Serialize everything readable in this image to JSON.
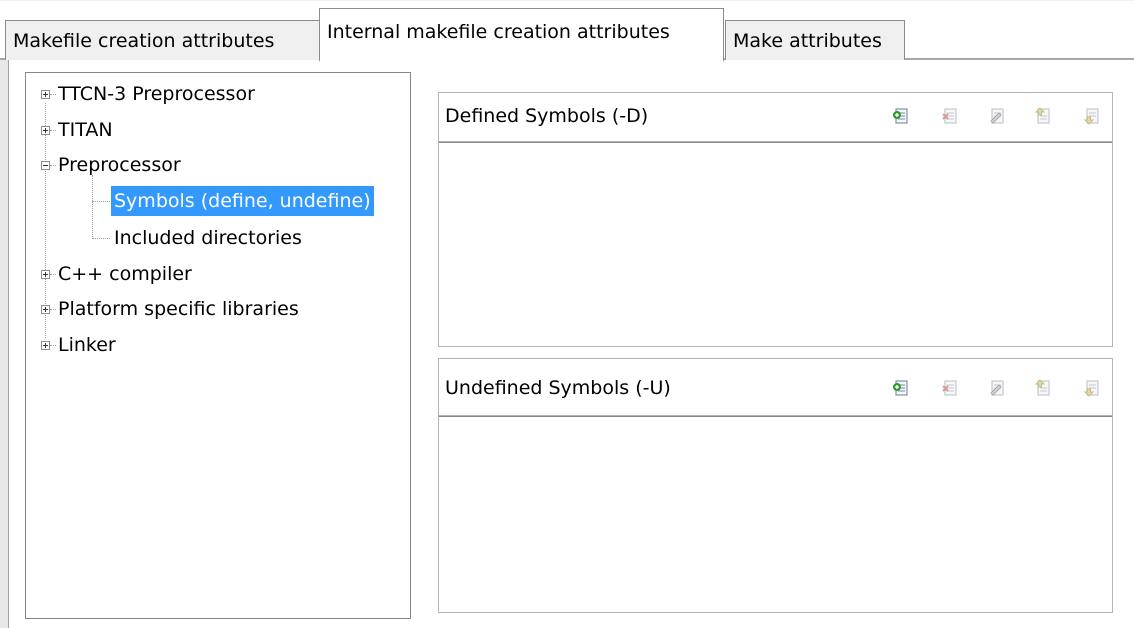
{
  "tabs": [
    {
      "label": "Makefile creation attributes"
    },
    {
      "label": "Internal makefile creation attributes"
    },
    {
      "label": "Make attributes"
    }
  ],
  "active_tab": "Internal makefile creation attributes",
  "tree": {
    "items": [
      {
        "label": "TTCN-3 Preprocessor",
        "expander": "plus"
      },
      {
        "label": "TITAN",
        "expander": "plus"
      },
      {
        "label": "Preprocessor",
        "expander": "minus"
      },
      {
        "label": "Symbols (define, undefine)",
        "selected": true
      },
      {
        "label": "Included directories"
      },
      {
        "label": "C++ compiler",
        "expander": "plus"
      },
      {
        "label": "Platform specific libraries",
        "expander": "plus"
      },
      {
        "label": "Linker",
        "expander": "plus"
      }
    ]
  },
  "defined": {
    "title": "Defined Symbols (-D)",
    "icons": [
      "add-icon",
      "delete-icon",
      "edit-icon",
      "move-up-icon",
      "move-down-icon"
    ]
  },
  "undefined": {
    "title": "Undefined Symbols (-U)",
    "icons": [
      "add-icon",
      "delete-icon",
      "edit-icon",
      "move-up-icon",
      "move-down-icon"
    ]
  },
  "colors": {
    "selection": "#3399ff",
    "add_icon_green": "#2e9b2e"
  }
}
